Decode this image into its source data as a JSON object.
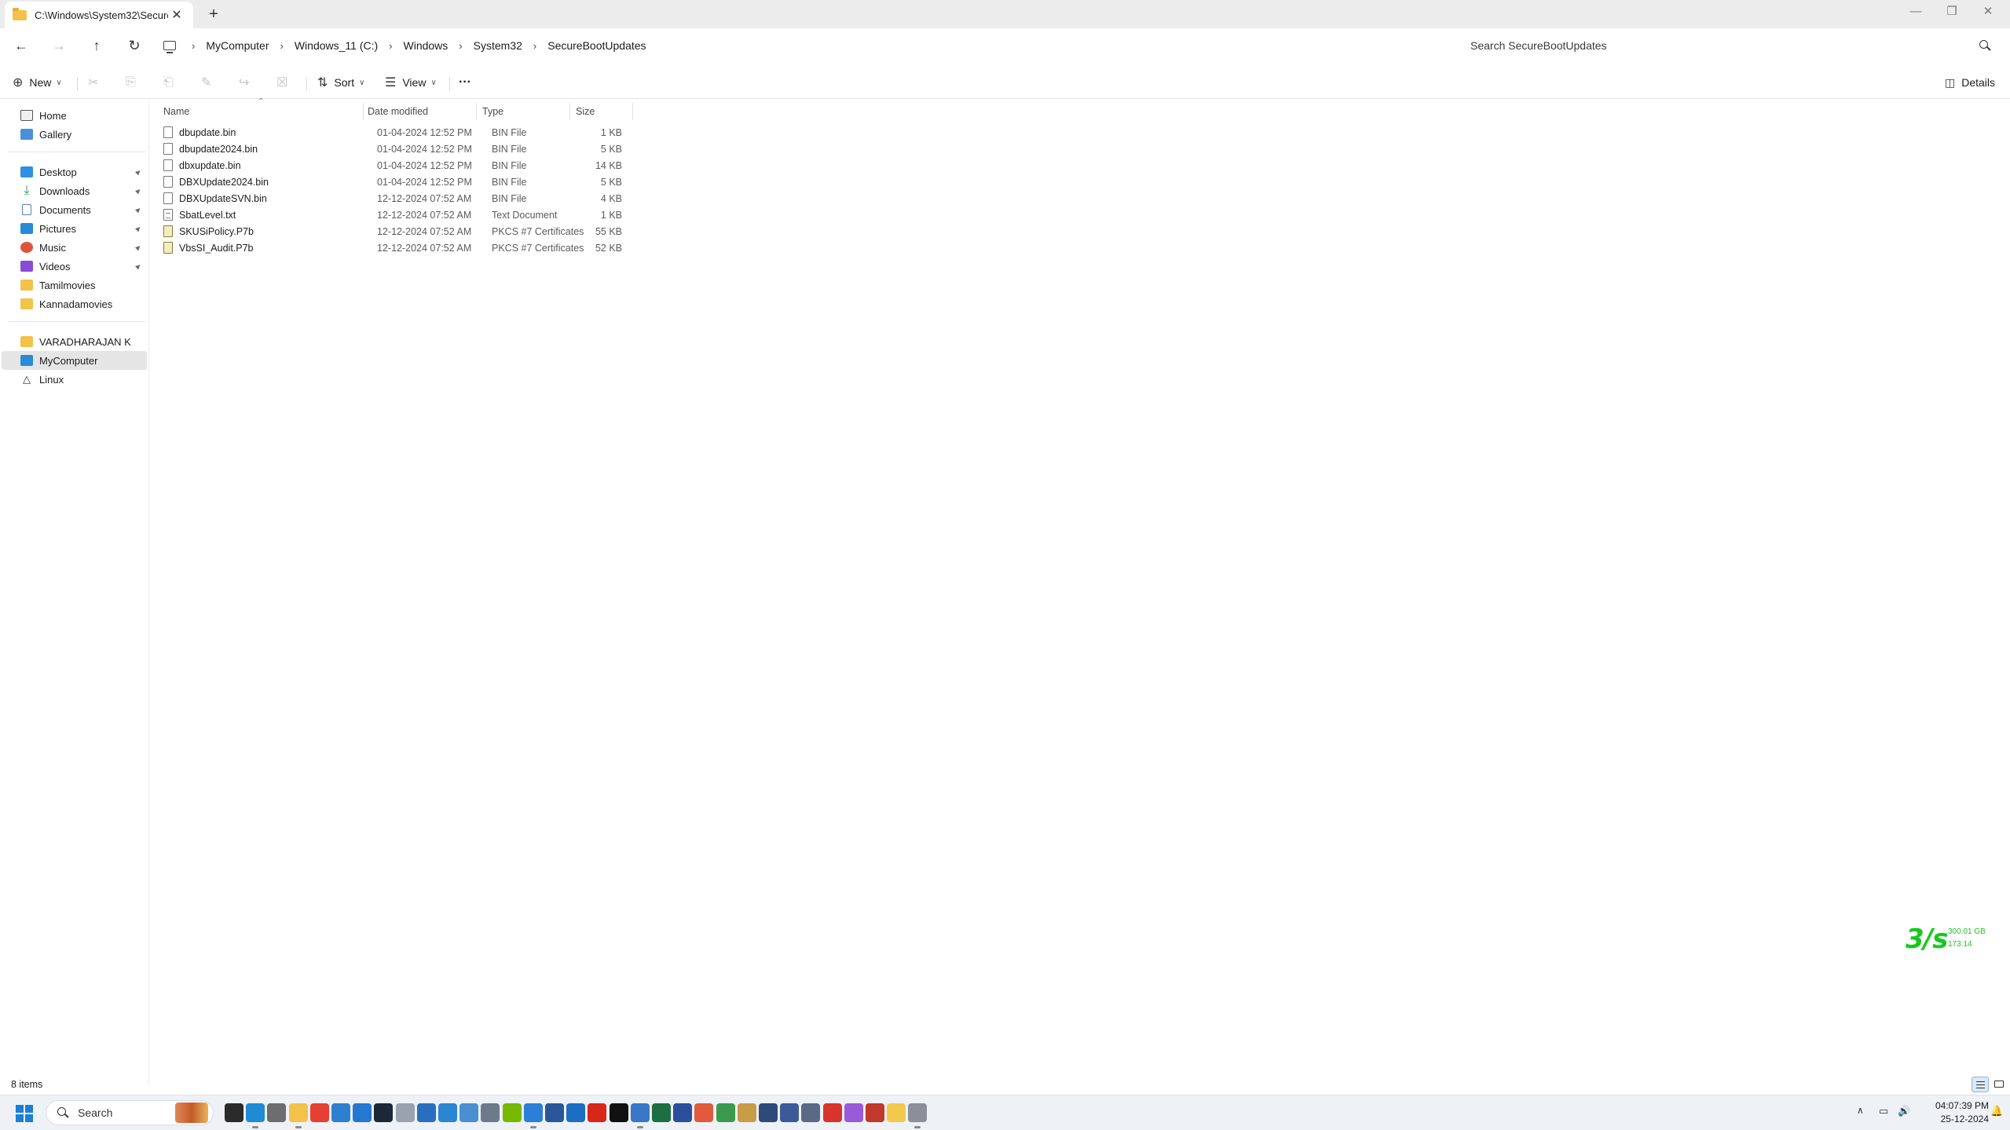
{
  "window": {
    "tab_title": "C:\\Windows\\System32\\Secure",
    "new_tab_symbol": "+",
    "close_symbol": "✕"
  },
  "breadcrumb": [
    "MyComputer",
    "Windows_11 (C:)",
    "Windows",
    "System32",
    "SecureBootUpdates"
  ],
  "search": {
    "placeholder": "Search SecureBootUpdates"
  },
  "commands": {
    "new": "New",
    "sort": "Sort",
    "view": "View",
    "more": "···",
    "details": "Details"
  },
  "sidebar": {
    "quick": [
      {
        "label": "Home",
        "icon": "home-icon"
      },
      {
        "label": "Gallery",
        "icon": "gallery-icon"
      }
    ],
    "pinned": [
      {
        "label": "Desktop",
        "icon": "desktop-folder-icon",
        "color": "#2f8fe0"
      },
      {
        "label": "Downloads",
        "icon": "downloads-icon",
        "color": "#1e9a56"
      },
      {
        "label": "Documents",
        "icon": "documents-icon",
        "color": "#5a7fbf"
      },
      {
        "label": "Pictures",
        "icon": "pictures-icon",
        "color": "#2b8ad8"
      },
      {
        "label": "Music",
        "icon": "music-icon",
        "color": "#e0533b"
      },
      {
        "label": "Videos",
        "icon": "videos-icon",
        "color": "#8a4bd6"
      },
      {
        "label": "Tamilmovies",
        "icon": "folder-icon",
        "color": "#f3c24b"
      },
      {
        "label": "Kannadamovies",
        "icon": "folder-icon",
        "color": "#f3c24b"
      }
    ],
    "locations": [
      {
        "label": "VARADHARAJAN K",
        "icon": "user-folder-icon",
        "color": "#f3c24b"
      },
      {
        "label": "MyComputer",
        "icon": "computer-icon",
        "color": "#2b8ad8"
      },
      {
        "label": "Linux",
        "icon": "linux-icon",
        "color": "#333333"
      }
    ]
  },
  "columns": {
    "name": "Name",
    "date": "Date modified",
    "type": "Type",
    "size": "Size"
  },
  "files": [
    {
      "name": "dbupdate.bin",
      "date": "01-04-2024 12:52 PM",
      "type": "BIN File",
      "size": "1 KB",
      "icon": "file-icon"
    },
    {
      "name": "dbupdate2024.bin",
      "date": "01-04-2024 12:52 PM",
      "type": "BIN File",
      "size": "5 KB",
      "icon": "file-icon"
    },
    {
      "name": "dbxupdate.bin",
      "date": "01-04-2024 12:52 PM",
      "type": "BIN File",
      "size": "14 KB",
      "icon": "file-icon"
    },
    {
      "name": "DBXUpdate2024.bin",
      "date": "01-04-2024 12:52 PM",
      "type": "BIN File",
      "size": "5 KB",
      "icon": "file-icon"
    },
    {
      "name": "DBXUpdateSVN.bin",
      "date": "12-12-2024 07:52 AM",
      "type": "BIN File",
      "size": "4 KB",
      "icon": "file-icon"
    },
    {
      "name": "SbatLevel.txt",
      "date": "12-12-2024 07:52 AM",
      "type": "Text Document",
      "size": "1 KB",
      "icon": "text-file-icon"
    },
    {
      "name": "SKUSiPolicy.P7b",
      "date": "12-12-2024 07:52 AM",
      "type": "PKCS #7 Certificates",
      "size": "55 KB",
      "icon": "certificate-icon"
    },
    {
      "name": "VbsSI_Audit.P7b",
      "date": "12-12-2024 07:52 AM",
      "type": "PKCS #7 Certificates",
      "size": "52 KB",
      "icon": "certificate-icon"
    }
  ],
  "widget": {
    "rate": "3/s",
    "size": "300.01 GB",
    "time": "173:14",
    "color": "#18c81f"
  },
  "status": {
    "item_count": "8 items"
  },
  "taskbar": {
    "search_label": "Search",
    "apps": [
      {
        "name": "task-view",
        "color": "#2b2b2b"
      },
      {
        "name": "edge",
        "color": "#1f8bd6"
      },
      {
        "name": "settings",
        "color": "#6d6d6d"
      },
      {
        "name": "file-explorer",
        "color": "#f3c24b"
      },
      {
        "name": "chrome",
        "color": "#e44134"
      },
      {
        "name": "vscode-like",
        "color": "#2f7fd0"
      },
      {
        "name": "store",
        "color": "#2478cf"
      },
      {
        "name": "steam",
        "color": "#1b2838"
      },
      {
        "name": "clock-app",
        "color": "#9aa3ad"
      },
      {
        "name": "r-app",
        "color": "#2a6fbf"
      },
      {
        "name": "photos",
        "color": "#2a86d2"
      },
      {
        "name": "image-viewer",
        "color": "#4a8fd0"
      },
      {
        "name": "snipping",
        "color": "#6c7a8c"
      },
      {
        "name": "nvidia",
        "color": "#76b900"
      },
      {
        "name": "notepad",
        "color": "#2b7fd8"
      },
      {
        "name": "word",
        "color": "#2b579a"
      },
      {
        "name": "photo-app",
        "color": "#1a6fc2"
      },
      {
        "name": "acrobat",
        "color": "#d8261b"
      },
      {
        "name": "nvidia-app",
        "color": "#111111"
      },
      {
        "name": "task-manager",
        "color": "#3a77c8"
      },
      {
        "name": "excel",
        "color": "#1d6f42"
      },
      {
        "name": "powershell",
        "color": "#2a4f9b"
      },
      {
        "name": "git-tool",
        "color": "#e05a3b"
      },
      {
        "name": "browser-green",
        "color": "#3b9a4e"
      },
      {
        "name": "archive-tool",
        "color": "#c99b45"
      },
      {
        "name": "vs-app",
        "color": "#2d4a7a"
      },
      {
        "name": "save-app",
        "color": "#3c5a9a"
      },
      {
        "name": "calculator",
        "color": "#5a6a86"
      },
      {
        "name": "maps",
        "color": "#d9342b"
      },
      {
        "name": "copilot",
        "color": "#9a5ad8"
      },
      {
        "name": "camera-app",
        "color": "#c0392b"
      },
      {
        "name": "sticky-notes",
        "color": "#f2c94c"
      },
      {
        "name": "misc-app",
        "color": "#8a8f99"
      }
    ],
    "clock_time": "04:07:39 PM",
    "clock_date": "25-12-2024"
  }
}
